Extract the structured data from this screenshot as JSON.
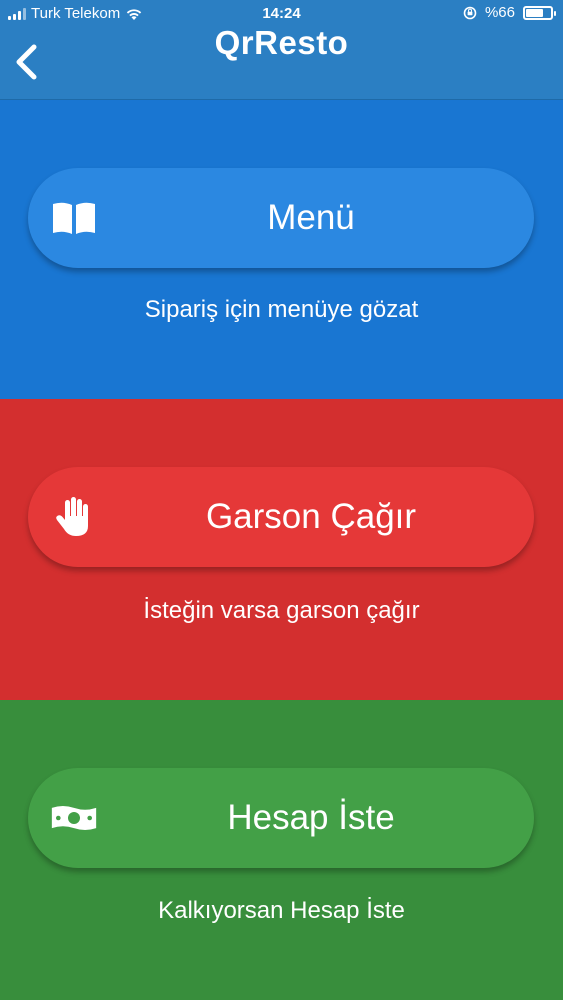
{
  "status_bar": {
    "carrier": "Turk Telekom",
    "time": "14:24",
    "battery_text": "%66",
    "battery_level": 0.66
  },
  "header": {
    "title": "QrResto",
    "back_icon": "chevron-left-icon"
  },
  "actions": [
    {
      "key": "menu",
      "label": "Menü",
      "caption": "Sipariş için menüye gözat",
      "icon": "book-open-icon",
      "color": "#1976d2"
    },
    {
      "key": "waiter",
      "label": "Garson Çağır",
      "caption": "İsteğin varsa garson çağır",
      "icon": "hand-icon",
      "color": "#d32f2f"
    },
    {
      "key": "bill",
      "label": "Hesap İste",
      "caption": "Kalkıyorsan Hesap İste",
      "icon": "money-bill-icon",
      "color": "#388e3c"
    }
  ]
}
